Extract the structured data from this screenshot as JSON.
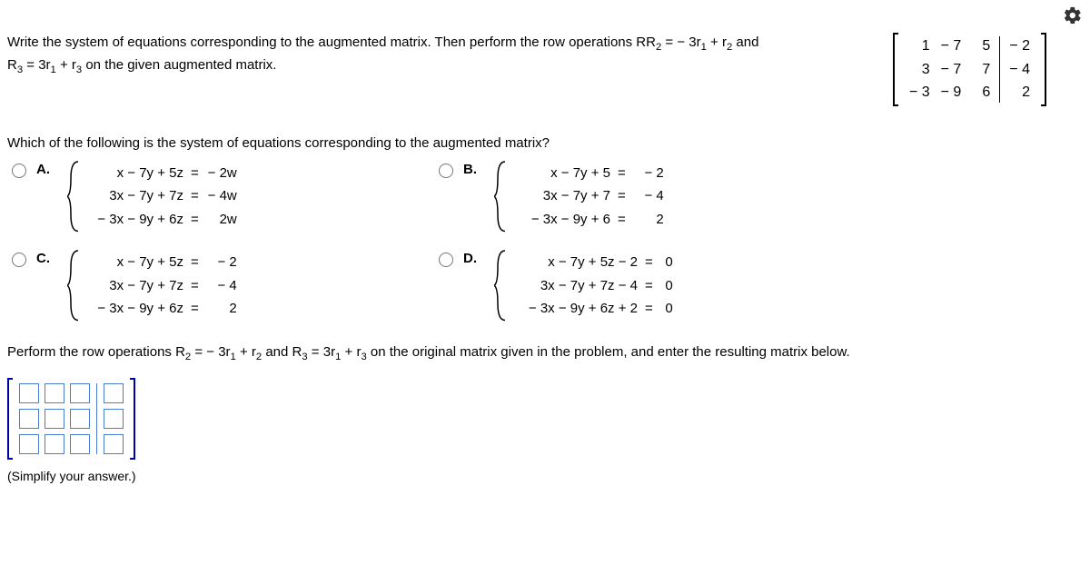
{
  "gear_title": "Settings",
  "prompt": {
    "line1_a": "Write the system of equations corresponding to the augmented matrix. Then perform the row operations R",
    "line1_sub1": "2",
    "line1_b": " = − 3r",
    "line1_sub2": "1",
    "line1_c": " + r",
    "line1_sub3": "2",
    "line1_d": " and",
    "line2_a": "R",
    "line2_sub1": "3",
    "line2_b": " = 3r",
    "line2_sub2": "1",
    "line2_c": " + r",
    "line2_sub3": "3",
    "line2_d": " on the given augmented matrix."
  },
  "matrix": {
    "r1c1": "1",
    "r1c2": "− 7",
    "r1c3": "5",
    "r1c4": "− 2",
    "r2c1": "3",
    "r2c2": "− 7",
    "r2c3": "7",
    "r2c4": "− 4",
    "r3c1": "− 3",
    "r3c2": "− 9",
    "r3c3": "6",
    "r3c4": "2"
  },
  "question": "Which of the following is the system of equations corresponding to the augmented matrix?",
  "choices": {
    "A": {
      "label": "A.",
      "rows": [
        {
          "lhs": "x − 7y + 5z",
          "rhs": "− 2w"
        },
        {
          "lhs": "3x − 7y + 7z",
          "rhs": "− 4w"
        },
        {
          "lhs": "− 3x − 9y + 6z",
          "rhs": "2w"
        }
      ]
    },
    "B": {
      "label": "B.",
      "rows": [
        {
          "lhs": "x − 7y + 5",
          "rhs": "− 2"
        },
        {
          "lhs": "3x − 7y + 7",
          "rhs": "− 4"
        },
        {
          "lhs": "− 3x − 9y + 6",
          "rhs": "2"
        }
      ]
    },
    "C": {
      "label": "C.",
      "rows": [
        {
          "lhs": "x − 7y + 5z",
          "rhs": "− 2"
        },
        {
          "lhs": "3x − 7y + 7z",
          "rhs": "− 4"
        },
        {
          "lhs": "− 3x − 9y + 6z",
          "rhs": "2"
        }
      ]
    },
    "D": {
      "label": "D.",
      "rows": [
        {
          "lhs": "x − 7y + 5z − 2",
          "rhs": "0"
        },
        {
          "lhs": "3x − 7y + 7z − 4",
          "rhs": "0"
        },
        {
          "lhs": "− 3x − 9y + 6z + 2",
          "rhs": "0"
        }
      ]
    }
  },
  "part2": {
    "a": "Perform the row operations R",
    "s1": "2",
    "b": " = − 3r",
    "s2": "1",
    "c": " + r",
    "s3": "2",
    "d": " and R",
    "s4": "3",
    "e": " = 3r",
    "s5": "1",
    "f": " + r",
    "s6": "3",
    "g": " on the original matrix given in the problem, and enter the resulting matrix below."
  },
  "simplify": "(Simplify your answer.)",
  "eq_sign": "="
}
